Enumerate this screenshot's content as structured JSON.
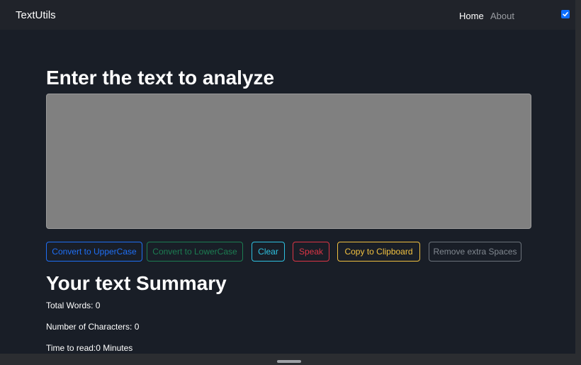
{
  "navbar": {
    "brand": "TextUtils",
    "links": [
      {
        "label": "Home",
        "active": true
      },
      {
        "label": "About",
        "active": false
      }
    ],
    "theme_toggle_checked": true
  },
  "main": {
    "heading": "Enter the text to analyze",
    "textarea_value": "",
    "buttons": [
      {
        "label": "Convert to UpperCase",
        "color": "#1f6ff5"
      },
      {
        "label": "Convert to LowerCase",
        "color": "#1c7d52"
      },
      {
        "label": "Clear",
        "color": "#2ec1e0"
      },
      {
        "label": "Speak",
        "color": "#dc3545"
      },
      {
        "label": "Copy to Clipboard",
        "color": "#f0c040"
      },
      {
        "label": "Remove extra Spaces",
        "color": "#818890"
      }
    ]
  },
  "summary": {
    "heading": "Your text Summary",
    "total_words": "Total Words: 0",
    "characters": "Number of Characters: 0",
    "time_to_read": "Time to read:0 Minutes"
  },
  "colors": {
    "background": "#191e27",
    "navbar": "#20232a",
    "textarea": "#808080",
    "accent": "#0d6efd"
  }
}
